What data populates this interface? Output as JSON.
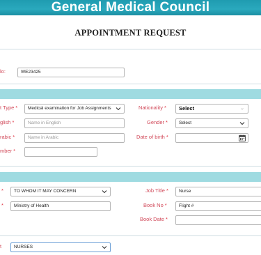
{
  "header": {
    "banner_title": "General Medical Council",
    "page_title": "APPOINTMENT REQUEST"
  },
  "ref": {
    "label": "lo:",
    "value": "WE23425"
  },
  "section1": {
    "exam_type": {
      "label": "t Type",
      "value": "Medical examination for Job Assignments"
    },
    "nationality": {
      "label": "Nationality",
      "value": "Select"
    },
    "name_en": {
      "label": "glish",
      "placeholder": "Name in English"
    },
    "gender": {
      "label": "Gender",
      "value": "Select"
    },
    "name_ar": {
      "label": "rabic",
      "placeholder": "Name in Arabic"
    },
    "dob": {
      "label": "Date of birth",
      "value": ""
    },
    "number": {
      "label": "mber",
      "value": ""
    }
  },
  "section2": {
    "to_whom": {
      "label": "",
      "value": "TO WHOM IT MAY CONCERN"
    },
    "job_title": {
      "label": "Job Title",
      "value": "Nurse"
    },
    "ministry": {
      "label": "",
      "value": "Ministry of Health"
    },
    "book_no": {
      "label": "Book No",
      "value": "Flight #"
    },
    "book_date": {
      "label": "Book Date",
      "value": ""
    }
  },
  "section3": {
    "category": {
      "label": "t",
      "value": "NURSES"
    }
  },
  "required_marker": "*"
}
